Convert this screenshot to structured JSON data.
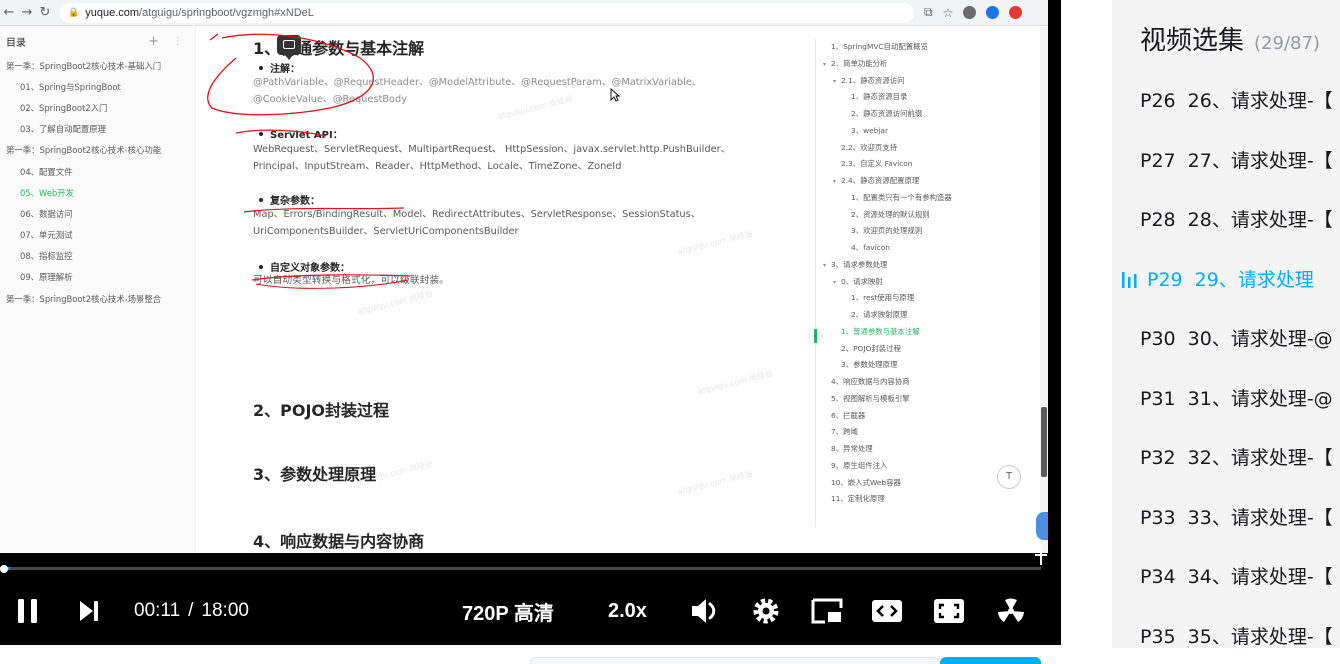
{
  "browser": {
    "url_host": "yuque.com",
    "url_path": "/atguigu/springboot/vgzmgh#xNDeL"
  },
  "sidebar": {
    "title": "目录",
    "items": [
      {
        "label": "第一季：SpringBoot2核心技术-基础入门",
        "level": 0
      },
      {
        "label": "01、Spring与SpringBoot",
        "level": 1
      },
      {
        "label": "02、SpringBoot2入门",
        "level": 1
      },
      {
        "label": "03、了解自动配置原理",
        "level": 1
      },
      {
        "label": "第一季：SpringBoot2核心技术-核心功能",
        "level": 0
      },
      {
        "label": "04、配置文件",
        "level": 1
      },
      {
        "label": "05、Web开发",
        "level": 1,
        "active": true
      },
      {
        "label": "06、数据访问",
        "level": 1
      },
      {
        "label": "07、单元测试",
        "level": 1
      },
      {
        "label": "08、指标监控",
        "level": 1
      },
      {
        "label": "09、原理解析",
        "level": 1
      },
      {
        "label": "第一季：SpringBoot2核心技术-场景整合",
        "level": 0
      }
    ]
  },
  "doc": {
    "heading1": "1、普通参数与基本注解",
    "annotations_label": "注解：",
    "annotations_text": "@PathVariable、@RequestHeader、@ModelAttribute、@RequestParam、@MatrixVariable、@CookieValue、@RequestBody",
    "servlet_label": "Servlet API：",
    "servlet_text": "WebRequest、ServletRequest、MultipartRequest、 HttpSession、javax.servlet.http.PushBuilder、Principal、InputStream、Reader、HttpMethod、Locale、TimeZone、ZoneId",
    "complex_label": "复杂参数：",
    "complex_text": "Map、Errors/BindingResult、Model、RedirectAttributes、ServletResponse、SessionStatus、UriComponentsBuilder、ServletUriComponentsBuilder",
    "custom_label": "自定义对象参数：",
    "custom_text": "可以自动类型转换与格式化，可以级联封装。",
    "heading2": "2、POJO封装过程",
    "heading3": "3、参数处理原理",
    "heading4": "4、响应数据与内容协商",
    "watermark": "atguigu.com 尚硅谷"
  },
  "outline": {
    "items": [
      {
        "label": "1、SpringMVC自动配置概览",
        "indent": 0,
        "caret": false
      },
      {
        "label": "2、简单功能分析",
        "indent": 0,
        "caret": true
      },
      {
        "label": "2.1、静态资源访问",
        "indent": 1,
        "caret": true
      },
      {
        "label": "1、静态资源目录",
        "indent": 2,
        "caret": false
      },
      {
        "label": "2、静态资源访问前缀",
        "indent": 2,
        "caret": false
      },
      {
        "label": "3、webjar",
        "indent": 2,
        "caret": false
      },
      {
        "label": "2.2、欢迎页支持",
        "indent": 1,
        "caret": false
      },
      {
        "label": "2.3、自定义 Favicon",
        "indent": 1,
        "caret": false
      },
      {
        "label": "2.4、静态资源配置原理",
        "indent": 1,
        "caret": true
      },
      {
        "label": "1、配置类只有一个有参构造器",
        "indent": 2,
        "caret": false
      },
      {
        "label": "2、资源处理的默认规则",
        "indent": 2,
        "caret": false
      },
      {
        "label": "3、欢迎页的处理规则",
        "indent": 2,
        "caret": false
      },
      {
        "label": "4、favicon",
        "indent": 2,
        "caret": false
      },
      {
        "label": "3、请求参数处理",
        "indent": 0,
        "caret": true
      },
      {
        "label": "0、请求映射",
        "indent": 1,
        "caret": true
      },
      {
        "label": "1、rest使用与原理",
        "indent": 2,
        "caret": false
      },
      {
        "label": "2、请求映射原理",
        "indent": 2,
        "caret": false
      },
      {
        "label": "1、普通参数与基本注解",
        "indent": 1,
        "caret": false,
        "active": true
      },
      {
        "label": "2、POJO封装过程",
        "indent": 1,
        "caret": false
      },
      {
        "label": "3、参数处理原理",
        "indent": 1,
        "caret": false
      },
      {
        "label": "4、响应数据与内容协商",
        "indent": 0,
        "caret": false
      },
      {
        "label": "5、视图解析与模板引擎",
        "indent": 0,
        "caret": false
      },
      {
        "label": "6、拦截器",
        "indent": 0,
        "caret": false
      },
      {
        "label": "7、跨域",
        "indent": 0,
        "caret": false
      },
      {
        "label": "8、异常处理",
        "indent": 0,
        "caret": false
      },
      {
        "label": "9、原生组件注入",
        "indent": 0,
        "caret": false
      },
      {
        "label": "10、嵌入式Web容器",
        "indent": 0,
        "caret": false
      },
      {
        "label": "11、定制化原理",
        "indent": 0,
        "caret": false
      }
    ],
    "top_button": "T"
  },
  "player": {
    "current_time": "00:11",
    "time_separator": "/",
    "duration": "18:00",
    "quality": "720P 高清",
    "speed": "2.0x",
    "progress": 0.01,
    "icons": [
      "pause-icon",
      "next-icon",
      "volume-icon",
      "settings-icon",
      "pip-icon",
      "widescreen-icon",
      "fullscreen-icon",
      "radiation-icon"
    ]
  },
  "playlist": {
    "title": "视频选集",
    "count": "(29/87)",
    "items": [
      {
        "num": "P26",
        "title": "26、请求处理-【"
      },
      {
        "num": "P27",
        "title": "27、请求处理-【"
      },
      {
        "num": "P28",
        "title": "28、请求处理-【"
      },
      {
        "num": "P29",
        "title": "29、请求处理",
        "active": true
      },
      {
        "num": "P30",
        "title": "30、请求处理-@"
      },
      {
        "num": "P31",
        "title": "31、请求处理-@"
      },
      {
        "num": "P32",
        "title": "32、请求处理-【"
      },
      {
        "num": "P33",
        "title": "33、请求处理-【"
      },
      {
        "num": "P34",
        "title": "34、请求处理-【"
      },
      {
        "num": "P35",
        "title": "35、请求处理-【"
      }
    ]
  },
  "colors": {
    "accent_green": "#25b864",
    "accent_blue": "#00aeec",
    "progress_blue": "#2196d6",
    "ink_red": "#e0141b"
  }
}
